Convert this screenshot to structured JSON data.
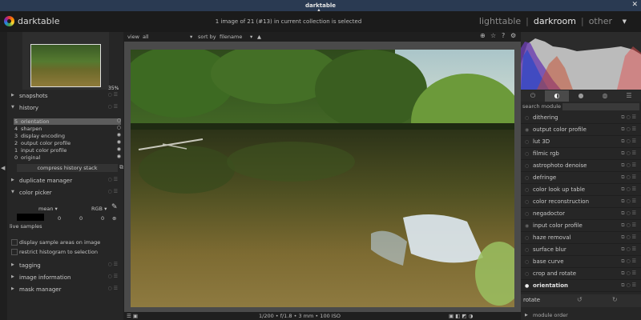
{
  "window": {
    "title": "darktable"
  },
  "header": {
    "brand": "darktable",
    "selection_info": "1 image of 21 (#13) in current collection is selected",
    "views": {
      "lighttable": "lighttable",
      "darkroom": "darkroom",
      "other": "other"
    }
  },
  "navigation": {
    "zoom": "35%"
  },
  "left": {
    "snapshots": "snapshots",
    "history": {
      "title": "history",
      "items": [
        {
          "num": "5",
          "name": "orientation"
        },
        {
          "num": "4",
          "name": "sharpen"
        },
        {
          "num": "3",
          "name": "display encoding"
        },
        {
          "num": "2",
          "name": "output color profile"
        },
        {
          "num": "1",
          "name": "input color profile"
        },
        {
          "num": "0",
          "name": "original"
        }
      ],
      "compress": "compress history stack"
    },
    "duplicate_manager": "duplicate manager",
    "color_picker": {
      "title": "color picker",
      "mode": "mean",
      "model": "RGB",
      "values": [
        "0",
        "0",
        "0"
      ],
      "live_samples": "live samples",
      "display_areas": "display sample areas on image",
      "restrict_hist": "restrict histogram to selection"
    },
    "tagging": "tagging",
    "image_information": "image information",
    "mask_manager": "mask manager"
  },
  "viewbar": {
    "view_label": "view",
    "view_value": "all",
    "sort_label": "sort by",
    "sort_value": "filename"
  },
  "bottom": {
    "exif": "1/200 • f/1.8 • 3 mm • 100 ISO"
  },
  "right": {
    "search_label": "search module",
    "modules": [
      "dithering",
      "output color profile",
      "lut 3D",
      "filmic rgb",
      "astrophoto denoise",
      "defringe",
      "color look up table",
      "color reconstruction",
      "negadoctor",
      "input color profile",
      "haze removal",
      "surface blur",
      "base curve",
      "crop and rotate",
      "orientation"
    ],
    "rotate_label": "rotate",
    "module_order": "module order"
  },
  "colors": {
    "titlebar": "#2a3a52",
    "panel": "#262626",
    "selected_history": "#5c5c5c"
  }
}
